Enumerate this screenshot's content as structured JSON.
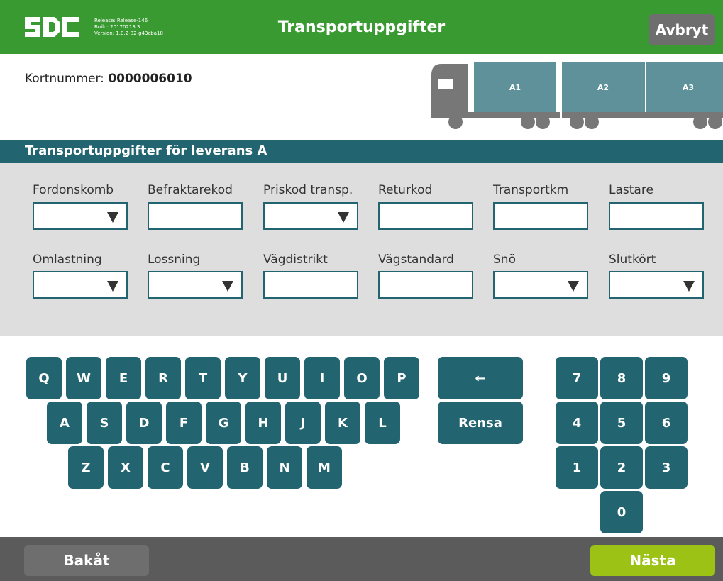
{
  "header": {
    "logo_text": "SDC",
    "release": "Release: Release-146",
    "build": "Build: 20170213.3",
    "version": "Version: 1.0.2-82-g43cba18",
    "title": "Transportuppgifter",
    "cancel_label": "Avbryt",
    "color": "#3a9a32"
  },
  "card": {
    "label": "Kortnummer:",
    "number": "0000006010"
  },
  "truck": {
    "compartments": [
      "A1",
      "A2",
      "A3"
    ],
    "compartment_color": "#5f919b",
    "body_color": "#777777"
  },
  "section": {
    "title": "Transportuppgifter för leverans A",
    "color": "#22646f"
  },
  "fields": [
    {
      "label": "Fordonskomb",
      "type": "select",
      "value": ""
    },
    {
      "label": "Befraktarekod",
      "type": "text",
      "value": ""
    },
    {
      "label": "Priskod transp.",
      "type": "select",
      "value": ""
    },
    {
      "label": "Returkod",
      "type": "text",
      "value": ""
    },
    {
      "label": "Transportkm",
      "type": "text",
      "value": ""
    },
    {
      "label": "Lastare",
      "type": "text",
      "value": ""
    },
    {
      "label": "Omlastning",
      "type": "select",
      "value": ""
    },
    {
      "label": "Lossning",
      "type": "select",
      "value": ""
    },
    {
      "label": "Vägdistrikt",
      "type": "text",
      "value": ""
    },
    {
      "label": "Vägstandard",
      "type": "text",
      "value": ""
    },
    {
      "label": "Snö",
      "type": "select",
      "value": ""
    },
    {
      "label": "Slutkört",
      "type": "select",
      "value": ""
    }
  ],
  "keyboard": {
    "rows": [
      [
        "Q",
        "W",
        "E",
        "R",
        "T",
        "Y",
        "U",
        "I",
        "O",
        "P"
      ],
      [
        "A",
        "S",
        "D",
        "F",
        "G",
        "H",
        "J",
        "K",
        "L"
      ],
      [
        "Z",
        "X",
        "C",
        "V",
        "B",
        "N",
        "M"
      ]
    ],
    "backspace": "←",
    "clear": "Rensa",
    "numpad": [
      "7",
      "8",
      "9",
      "4",
      "5",
      "6",
      "1",
      "2",
      "3",
      "0"
    ]
  },
  "footer": {
    "back_label": "Bakåt",
    "next_label": "Nästa",
    "next_color": "#9cc215"
  }
}
